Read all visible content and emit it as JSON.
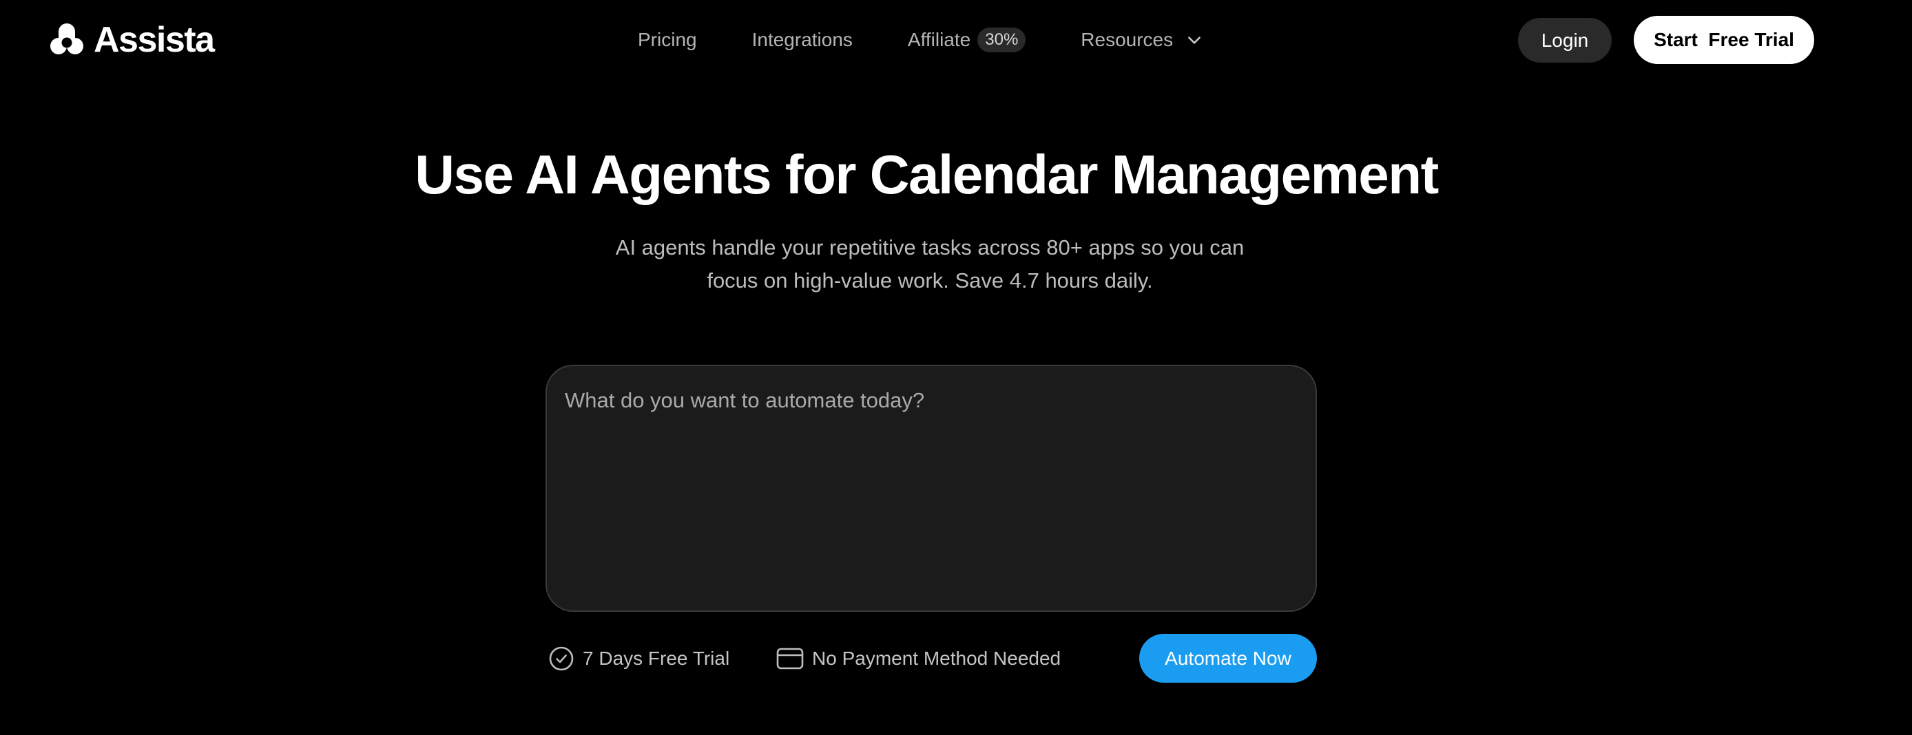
{
  "brand": {
    "name": "Assista",
    "logo_icon": "assista-logo-icon"
  },
  "nav": {
    "items": [
      {
        "label": "Pricing"
      },
      {
        "label": "Integrations"
      },
      {
        "label": "Affiliate",
        "badge": "30%"
      },
      {
        "label": "Resources",
        "icon": "chevron-down-icon"
      }
    ]
  },
  "header": {
    "login_label": "Login",
    "trial_label": "Start  Free Trial"
  },
  "hero": {
    "title": "Use AI Agents for Calendar Management",
    "subtitle_line1": "AI agents handle your repetitive tasks across 80+ apps so you can",
    "subtitle_line2": "focus on high-value work. Save 4.7 hours daily."
  },
  "prompt": {
    "placeholder": "What do you want to automate today?",
    "value": ""
  },
  "features": [
    {
      "label": "7 Days Free Trial",
      "icon": "check-circle-icon"
    },
    {
      "label": "No Payment Method Needed",
      "icon": "credit-card-icon"
    }
  ],
  "cta": {
    "label": "Automate Now"
  },
  "colors": {
    "background": "#000000",
    "accent": "#1a9cf0",
    "input_bg": "#1b1b1b",
    "muted_text": "#b5b5b5"
  }
}
